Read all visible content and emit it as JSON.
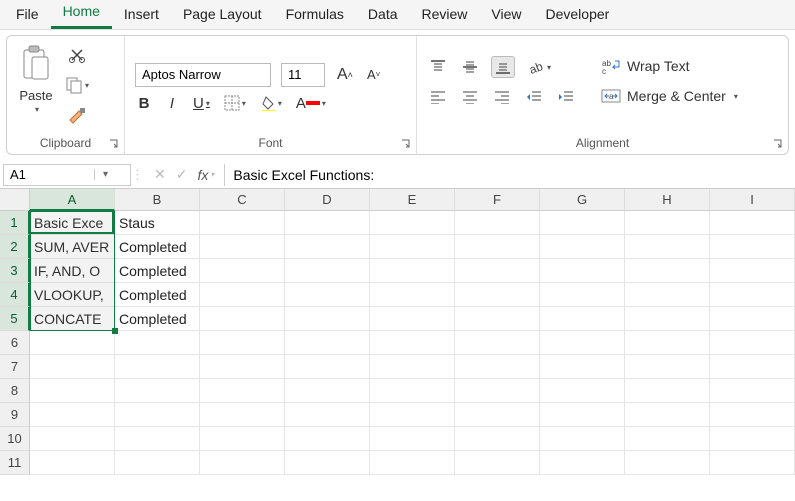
{
  "tabs": [
    "File",
    "Home",
    "Insert",
    "Page Layout",
    "Formulas",
    "Data",
    "Review",
    "View",
    "Developer"
  ],
  "activeTab": "Home",
  "ribbon": {
    "clipboard": {
      "label": "Clipboard",
      "paste": "Paste"
    },
    "font": {
      "label": "Font",
      "name": "Aptos Narrow",
      "size": "11",
      "bold": "B",
      "italic": "I",
      "underline": "U"
    },
    "alignment": {
      "label": "Alignment",
      "wrap": "Wrap Text",
      "merge": "Merge & Center"
    }
  },
  "namebox": "A1",
  "formula": "Basic Excel Functions:",
  "columns": [
    "A",
    "B",
    "C",
    "D",
    "E",
    "F",
    "G",
    "H",
    "I"
  ],
  "rows": [
    "1",
    "2",
    "3",
    "4",
    "5",
    "6",
    "7",
    "8",
    "9",
    "10",
    "11"
  ],
  "cells": {
    "A1": "Basic Excel Functions:",
    "A2": "SUM, AVERAGE, COUNT",
    "A3": "IF, AND, OR",
    "A4": "VLOOKUP, HLOOKUP",
    "A5": "CONCATENATE",
    "B1": "Staus",
    "B2": "Completed",
    "B3": "Completed",
    "B4": "Completed",
    "B5": "Completed"
  },
  "display": {
    "A1": "Basic Exce",
    "A2": "SUM, AVER",
    "A3": "IF, AND, O",
    "A4": "VLOOKUP,",
    "A5": "CONCATE",
    "B1": "Staus",
    "B2": "Completed",
    "B3": "Completed",
    "B4": "Completed",
    "B5": "Completed"
  },
  "selection": {
    "activeCell": "A1",
    "range": "A1:A5"
  }
}
